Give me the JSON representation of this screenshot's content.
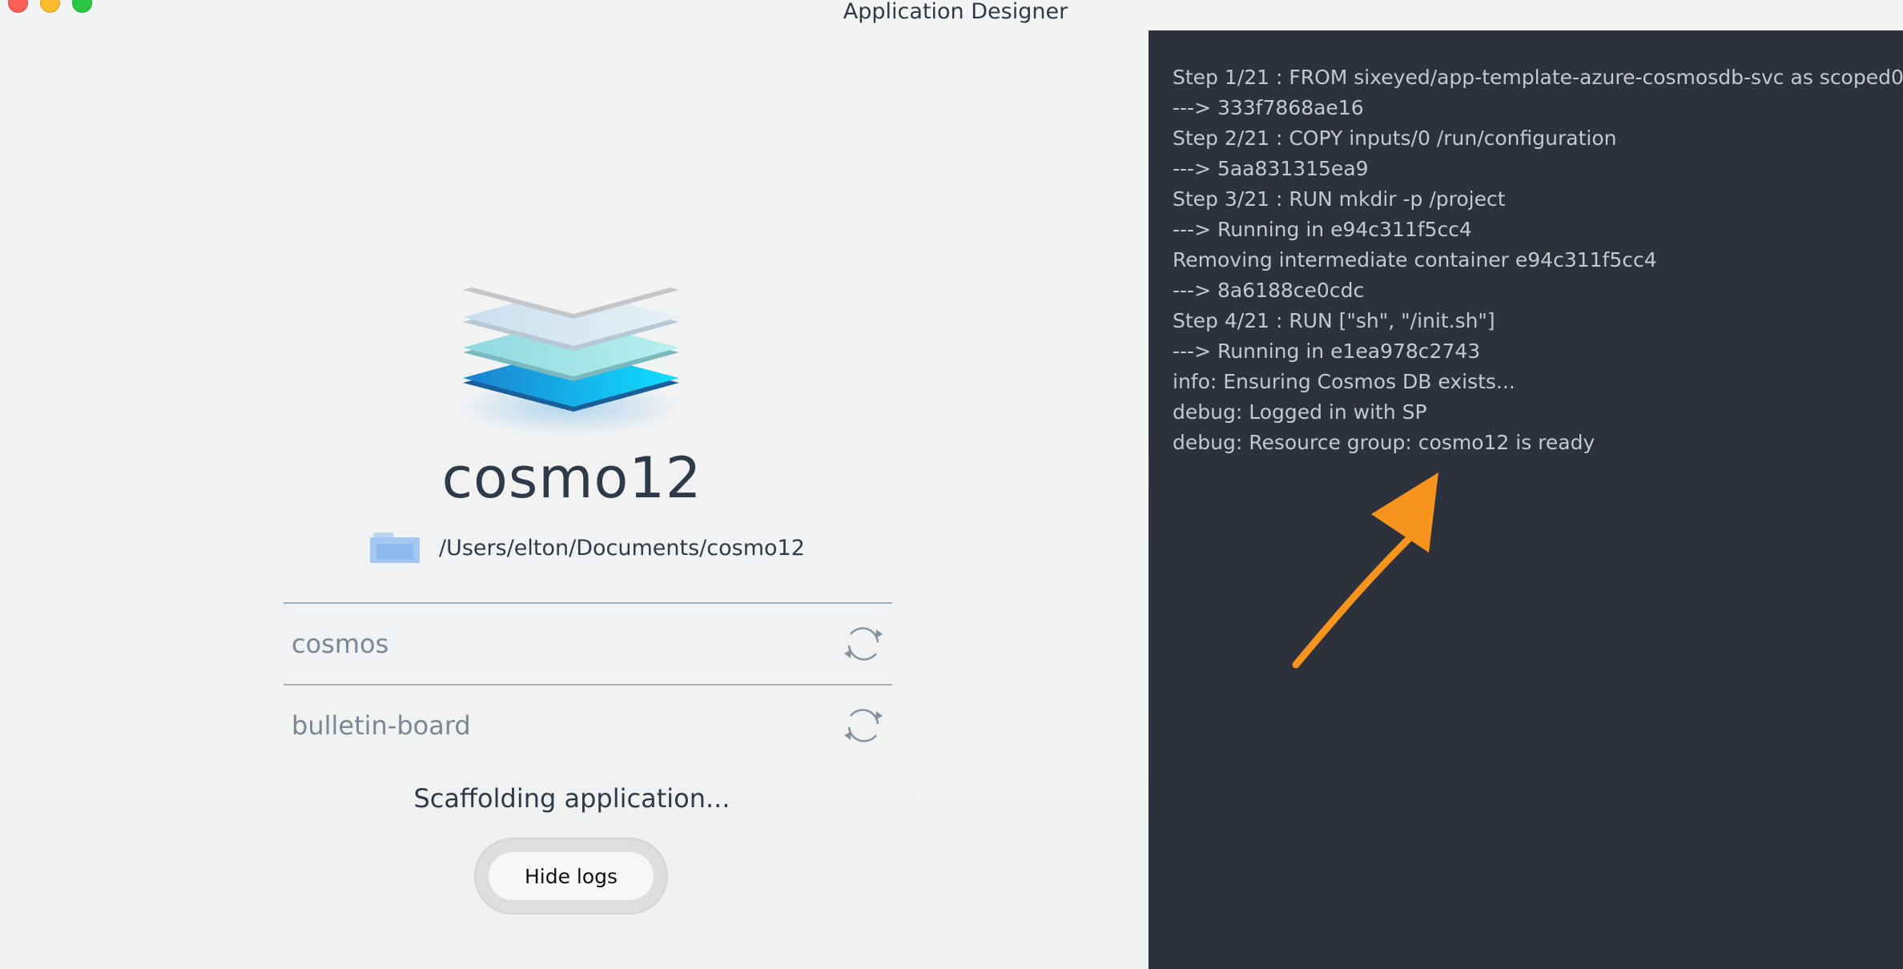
{
  "window": {
    "title": "Application Designer"
  },
  "project": {
    "name": "cosmo12",
    "path": "/Users/elton/Documents/cosmo12"
  },
  "services": [
    {
      "name": "cosmos",
      "icon": "refresh-icon"
    },
    {
      "name": "bulletin-board",
      "icon": "refresh-icon"
    }
  ],
  "status": {
    "text": "Scaffolding application..."
  },
  "buttons": {
    "hide_logs": "Hide logs"
  },
  "logs": [
    "Step 1/21 : FROM sixeyed/app-template-azure-cosmosdb-svc as scoped0",
    "---> 333f7868ae16",
    "Step 2/21 : COPY inputs/0 /run/configuration",
    "---> 5aa831315ea9",
    "Step 3/21 : RUN mkdir -p /project",
    "---> Running in e94c311f5cc4",
    "Removing intermediate container e94c311f5cc4",
    "---> 8a6188ce0cdc",
    "Step 4/21 : RUN [\"sh\", \"/init.sh\"]",
    "---> Running in e1ea978c2743",
    "info: Ensuring Cosmos DB exists...",
    "debug: Logged in with SP",
    "debug: Resource group: cosmo12 is ready"
  ],
  "colors": {
    "log_background": "#2c313c",
    "log_text": "#c4c8cf",
    "annotation_arrow": "#f7941d"
  }
}
